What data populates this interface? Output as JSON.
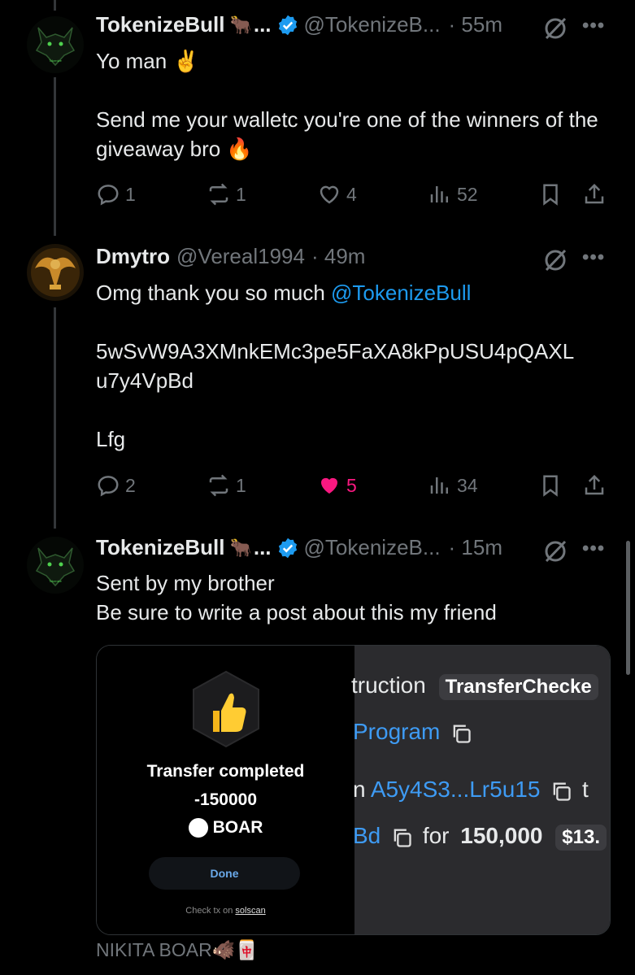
{
  "tweets": [
    {
      "name": "TokenizeBull",
      "name_emoji": "🐂",
      "ellipsis": "...",
      "handle": "@TokenizeB...",
      "time": "· 55m",
      "text": "Yo man ✌️\n\nSend me your walletc you're one of the winners of the giveaway bro 🔥",
      "replies": "1",
      "reposts": "1",
      "likes": "4",
      "views": "52"
    },
    {
      "name": "Dmytro",
      "handle": "@Vereal1994",
      "time": "· 49m",
      "text_prefix": "Omg thank you so much ",
      "mention": "@TokenizeBull",
      "text_rest": "\n\n5wSvW9A3XMnkEMc3pe5FaXA8kPpUSU4pQAXL u7y4VpBd\n\nLfg",
      "replies": "2",
      "reposts": "1",
      "likes": "5",
      "views": "34"
    },
    {
      "name": "TokenizeBull",
      "name_emoji": "🐂",
      "ellipsis": "...",
      "handle": "@TokenizeB...",
      "time": "· 15m",
      "text": "Sent by my brother\nBe sure to write a post about this my friend"
    }
  ],
  "media": {
    "transfer_title": "Transfer completed",
    "amount": "-150000",
    "token": "BOAR",
    "done_label": "Done",
    "check_tx_prefix": "Check tx on ",
    "check_tx_link": "solscan",
    "right": {
      "line1_text": "truction",
      "line1_pill": "TransferChecke",
      "line2_link": "Program",
      "line3_prefix": "n",
      "line3_link": "A5y4S3...Lr5u15",
      "line3_suffix": "t",
      "line4_link": "Bd",
      "line4_for": "for",
      "line4_amount": "150,000",
      "line4_pill": "$13."
    }
  },
  "footer_text": "NIKITA BOAR🐗🀄",
  "colors": {
    "accent": "#1d9bf0",
    "like": "#f91880",
    "muted": "#71767b"
  }
}
